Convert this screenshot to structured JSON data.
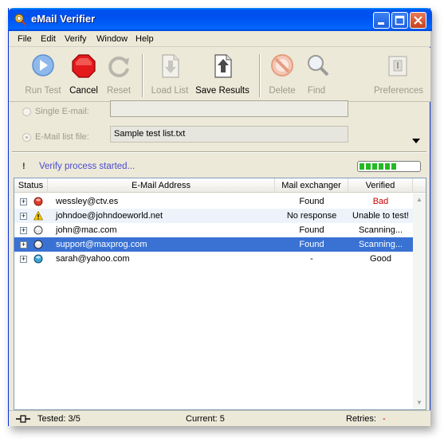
{
  "window": {
    "title": "eMail Verifier"
  },
  "menu": [
    "File",
    "Edit",
    "Verify",
    "Window",
    "Help"
  ],
  "toolbar": {
    "run": "Run Test",
    "cancel": "Cancel",
    "reset": "Reset",
    "load": "Load List",
    "save": "Save Results",
    "delete": "Delete",
    "find": "Find",
    "preferences": "Preferences"
  },
  "form": {
    "single_label": "Single E-mail:",
    "single_value": "",
    "list_label": "E-Mail list file:",
    "list_value": "Sample test list.txt"
  },
  "status": {
    "message": "Verify process started...",
    "progress": 0.7
  },
  "table": {
    "headers": [
      "Status",
      "E-Mail Address",
      "Mail exchanger",
      "Verified"
    ],
    "rows": [
      {
        "email": "wessley@ctv.es",
        "mx": "Found",
        "verified": "Bad"
      },
      {
        "email": "johndoe@johndoeworld.net",
        "mx": "No response",
        "verified": "Unable to test!"
      },
      {
        "email": "john@mac.com",
        "mx": "Found",
        "verified": "Scanning..."
      },
      {
        "email": "support@maxprog.com",
        "mx": "Found",
        "verified": "Scanning..."
      },
      {
        "email": "sarah@yahoo.com",
        "mx": "-",
        "verified": "Good"
      }
    ]
  },
  "statusbar": {
    "tested": "Tested: 3/5",
    "current": "Current:  5",
    "retries": "Retries:",
    "retries_value": "-"
  },
  "colors": {
    "bad": "#cc0000",
    "selection": "#3a72d4",
    "status_text": "#4b4bd0"
  }
}
